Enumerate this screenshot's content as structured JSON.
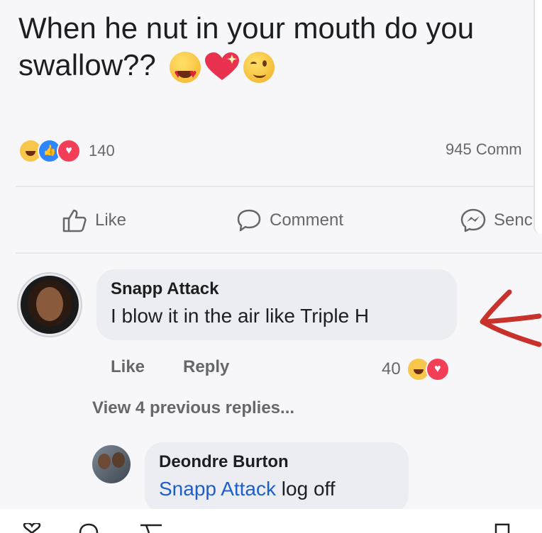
{
  "post": {
    "text": "When he nut in your mouth do you swallow??",
    "emojis": [
      "heart-eyes-emoji",
      "sparkling-heart-emoji",
      "winking-emoji"
    ]
  },
  "reactions": {
    "types": [
      "haha",
      "like",
      "love"
    ],
    "count": "140",
    "comments": "945 Comm"
  },
  "actions": {
    "like": "Like",
    "comment": "Comment",
    "send": "Senc"
  },
  "comment1": {
    "author": "Snapp Attack",
    "text": "I blow it in the air like Triple H",
    "like": "Like",
    "reply": "Reply",
    "reaction_count": "40",
    "reaction_types": [
      "haha",
      "love"
    ]
  },
  "view_replies": "View 4 previous replies...",
  "comment2": {
    "author": "Deondre Burton",
    "mention": "Snapp Attack",
    "text": "log off"
  },
  "colors": {
    "background": "#f7f7f9",
    "bubble": "#ebedf2",
    "meta_text": "#65676b",
    "mention": "#1d5ec9",
    "arrow": "#c9322a"
  }
}
